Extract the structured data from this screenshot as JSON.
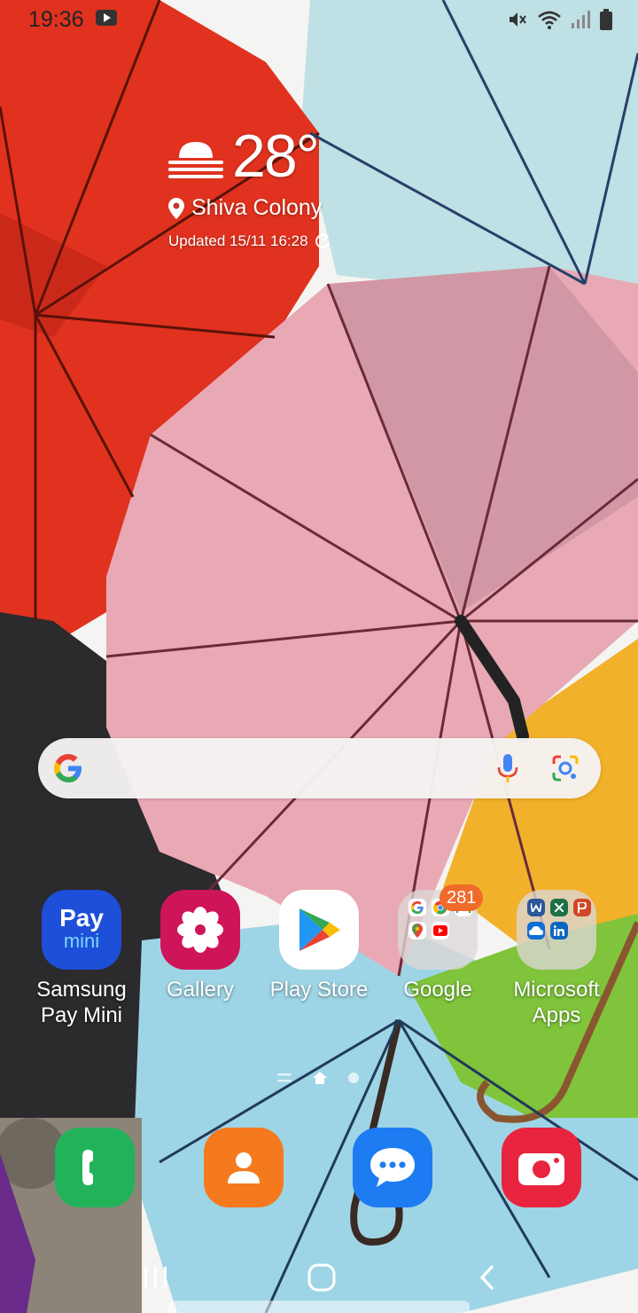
{
  "status_bar": {
    "time": "19:36",
    "notification_icons": [
      "youtube-icon"
    ],
    "status_icons": [
      "mute-icon",
      "wifi-icon",
      "signal-icon",
      "battery-icon"
    ]
  },
  "weather": {
    "temperature": "28°",
    "icon": "cloudy-haze-icon",
    "location": "Shiva Colony",
    "updated": "Updated 15/11 16:28"
  },
  "search": {
    "logo": "google-g-icon",
    "voice_icon": "mic-icon",
    "lens_icon": "google-lens-icon"
  },
  "apps": [
    {
      "label": "Samsung Pay Mini",
      "icon": "samsung-pay-mini-icon",
      "icon_text_top": "Pay",
      "icon_text_bottom": "mini"
    },
    {
      "label": "Gallery",
      "icon": "gallery-icon"
    },
    {
      "label": "Play Store",
      "icon": "play-store-icon"
    },
    {
      "label": "Google",
      "icon": "google-folder-icon",
      "badge": "281",
      "contents": [
        "google-icon",
        "chrome-icon",
        "gmail-icon",
        "maps-icon",
        "youtube-icon"
      ]
    },
    {
      "label": "Microsoft Apps",
      "icon": "microsoft-folder-icon",
      "contents": [
        "word-icon",
        "excel-icon",
        "powerpoint-icon",
        "onedrive-icon",
        "linkedin-icon"
      ]
    }
  ],
  "page_indicator": {
    "pages": [
      "list-page",
      "home-page",
      "page-2"
    ],
    "active": "home-page"
  },
  "dock": [
    {
      "name": "phone",
      "icon": "phone-icon",
      "color": "#22b35a"
    },
    {
      "name": "contacts",
      "icon": "contacts-icon",
      "color": "#f57a1e"
    },
    {
      "name": "messages",
      "icon": "messages-icon",
      "color": "#1e7cf2"
    },
    {
      "name": "camera",
      "icon": "camera-icon",
      "color": "#e8243f"
    }
  ],
  "nav_bar": [
    "recents-button",
    "home-button",
    "back-button"
  ],
  "colors": {
    "gallery": "#cf1559",
    "play_store_bg": "#ffffff",
    "samsung_pay": "#1d4fd8",
    "badge": "#f06a2a"
  }
}
